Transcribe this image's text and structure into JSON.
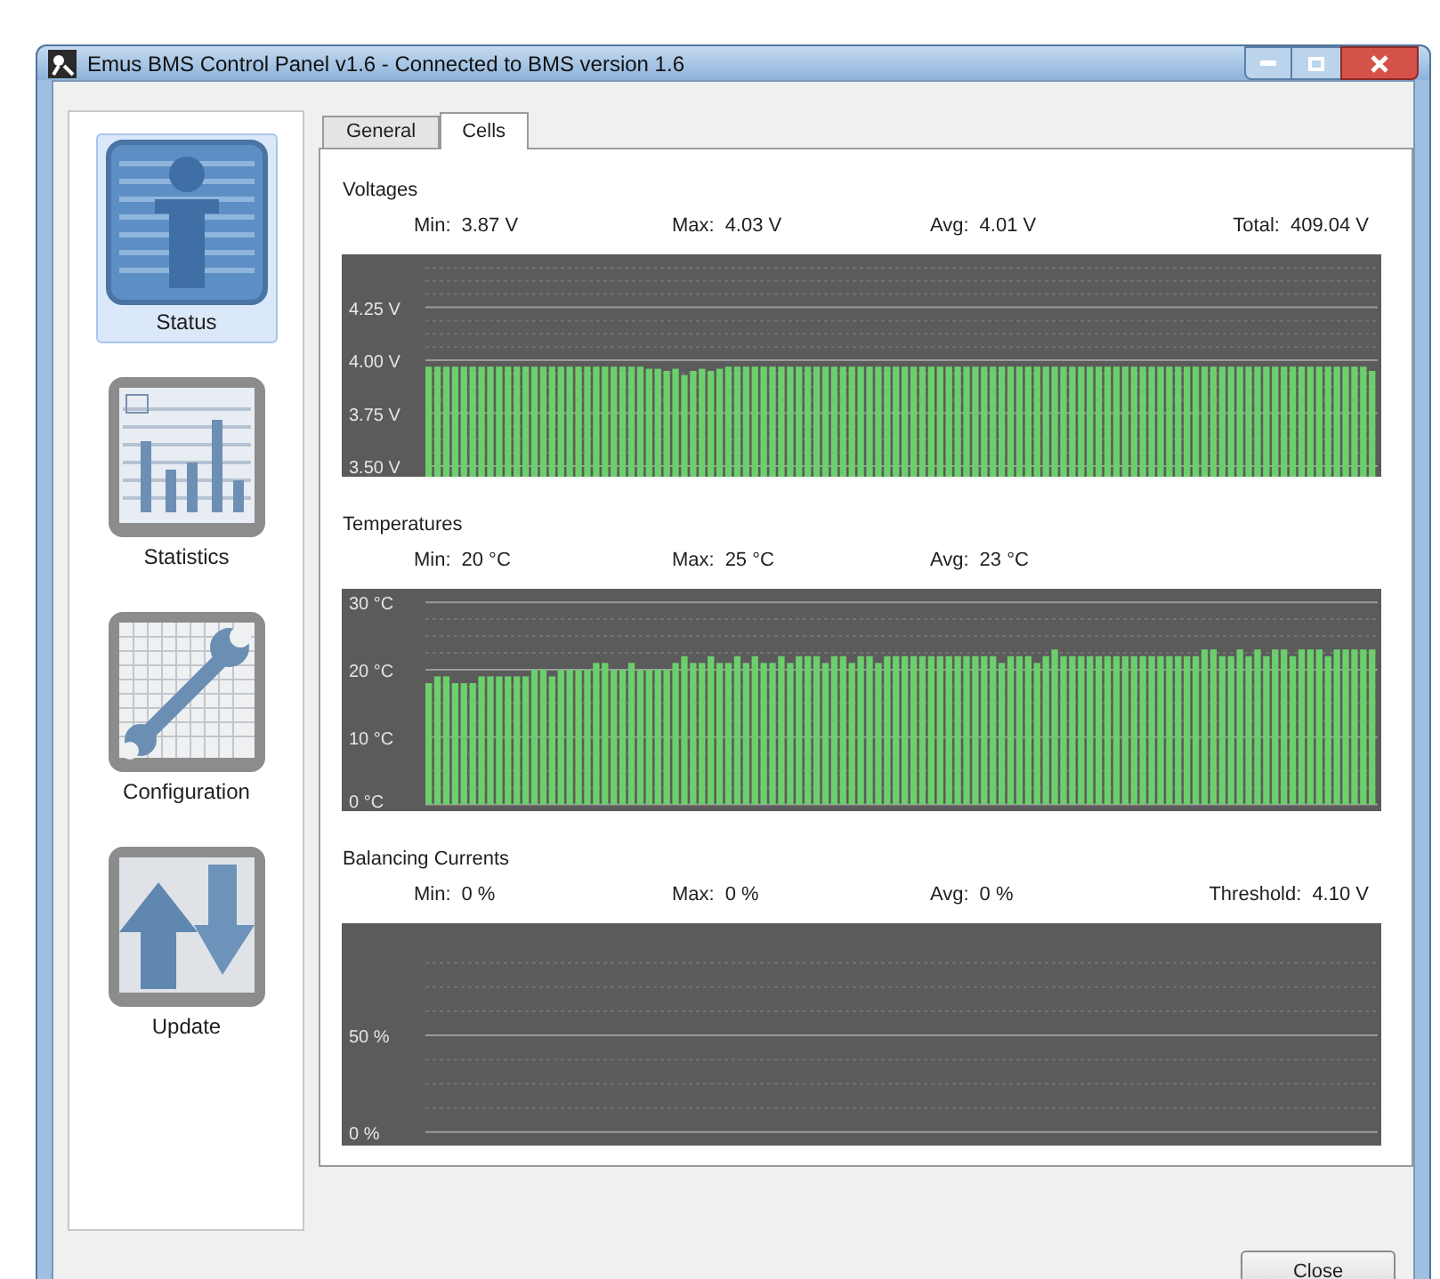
{
  "window": {
    "title": "Emus BMS Control Panel v1.6 - Connected to BMS version 1.6"
  },
  "sidebar": {
    "items": [
      {
        "label": "Status",
        "kind": "status",
        "selected": true
      },
      {
        "label": "Statistics",
        "kind": "statistics",
        "selected": false
      },
      {
        "label": "Configuration",
        "kind": "configuration",
        "selected": false
      },
      {
        "label": "Update",
        "kind": "update",
        "selected": false
      }
    ]
  },
  "tabs": [
    {
      "label": "General",
      "selected": false
    },
    {
      "label": "Cells",
      "selected": true
    }
  ],
  "sections": [
    {
      "title": "Voltages",
      "stats": [
        {
          "label": "Min:",
          "value": "3.87 V"
        },
        {
          "label": "Max:",
          "value": "4.03 V"
        },
        {
          "label": "Avg:",
          "value": "4.01 V"
        },
        {
          "label": "Total:",
          "value": "409.04 V"
        }
      ],
      "chart_data": {
        "type": "bar",
        "ylim": [
          3.45,
          4.5
        ],
        "yticks": [
          {
            "value": 3.5,
            "label": "3.50 V"
          },
          {
            "value": 3.75,
            "label": "3.75 V"
          },
          {
            "value": 4.0,
            "label": "4.00 V"
          },
          {
            "value": 4.25,
            "label": "4.25 V"
          }
        ],
        "grid": true,
        "color": "#6ccf6c",
        "values": [
          3.97,
          3.97,
          3.97,
          3.97,
          3.97,
          3.97,
          3.97,
          3.97,
          3.97,
          3.97,
          3.97,
          3.97,
          3.97,
          3.97,
          3.97,
          3.97,
          3.97,
          3.97,
          3.97,
          3.97,
          3.97,
          3.97,
          3.97,
          3.97,
          3.97,
          3.96,
          3.96,
          3.95,
          3.96,
          3.93,
          3.95,
          3.96,
          3.95,
          3.96,
          3.97,
          3.97,
          3.97,
          3.97,
          3.97,
          3.97,
          3.97,
          3.97,
          3.97,
          3.97,
          3.97,
          3.97,
          3.97,
          3.97,
          3.97,
          3.97,
          3.97,
          3.97,
          3.97,
          3.97,
          3.97,
          3.97,
          3.97,
          3.97,
          3.97,
          3.97,
          3.97,
          3.97,
          3.97,
          3.97,
          3.97,
          3.97,
          3.97,
          3.97,
          3.97,
          3.97,
          3.97,
          3.97,
          3.97,
          3.97,
          3.97,
          3.97,
          3.97,
          3.97,
          3.97,
          3.97,
          3.97,
          3.97,
          3.97,
          3.97,
          3.97,
          3.97,
          3.97,
          3.97,
          3.97,
          3.97,
          3.97,
          3.97,
          3.97,
          3.97,
          3.97,
          3.97,
          3.97,
          3.97,
          3.97,
          3.97,
          3.97,
          3.97,
          3.97,
          3.97,
          3.97,
          3.97,
          3.97,
          3.95
        ]
      }
    },
    {
      "title": "Temperatures",
      "stats": [
        {
          "label": "Min:",
          "value": "20 °C"
        },
        {
          "label": "Max:",
          "value": "25 °C"
        },
        {
          "label": "Avg:",
          "value": "23 °C"
        }
      ],
      "chart_data": {
        "type": "bar",
        "ylim": [
          -1,
          32
        ],
        "yticks": [
          {
            "value": 0,
            "label": "0 °C"
          },
          {
            "value": 10,
            "label": "10 °C"
          },
          {
            "value": 20,
            "label": "20 °C"
          },
          {
            "value": 30,
            "label": "30 °C"
          }
        ],
        "grid": true,
        "color": "#6ccf6c",
        "values": [
          18,
          19,
          19,
          18,
          18,
          18,
          19,
          19,
          19,
          19,
          19,
          19,
          20,
          20,
          19,
          20,
          20,
          20,
          20,
          21,
          21,
          20,
          20,
          21,
          20,
          20,
          20,
          20,
          21,
          22,
          21,
          21,
          22,
          21,
          21,
          22,
          21,
          22,
          21,
          21,
          22,
          21,
          22,
          22,
          22,
          21,
          22,
          22,
          21,
          22,
          22,
          21,
          22,
          22,
          22,
          22,
          22,
          22,
          22,
          22,
          22,
          22,
          22,
          22,
          22,
          21,
          22,
          22,
          22,
          21,
          22,
          23,
          22,
          22,
          22,
          22,
          22,
          22,
          22,
          22,
          22,
          22,
          22,
          22,
          22,
          22,
          22,
          22,
          23,
          23,
          22,
          22,
          23,
          22,
          23,
          22,
          23,
          23,
          22,
          23,
          23,
          23,
          22,
          23,
          23,
          23,
          23,
          23
        ]
      }
    },
    {
      "title": "Balancing Currents",
      "stats": [
        {
          "label": "Min:",
          "value": "0 %"
        },
        {
          "label": "Max:",
          "value": "0 %"
        },
        {
          "label": "Avg:",
          "value": "0 %"
        },
        {
          "label": "Threshold:",
          "value": "4.10 V"
        }
      ],
      "chart_data": {
        "type": "bar",
        "ylim": [
          -7,
          108
        ],
        "yticks": [
          {
            "value": 0,
            "label": "0 %"
          },
          {
            "value": 50,
            "label": "50 %"
          }
        ],
        "grid": true,
        "color": "#6ccf6c",
        "values": [
          0,
          0,
          0,
          0,
          0,
          0,
          0,
          0,
          0,
          0,
          0,
          0,
          0,
          0,
          0,
          0,
          0,
          0,
          0,
          0,
          0,
          0,
          0,
          0,
          0,
          0,
          0,
          0,
          0,
          0,
          0,
          0,
          0,
          0,
          0,
          0,
          0,
          0,
          0,
          0,
          0,
          0,
          0,
          0,
          0,
          0,
          0,
          0,
          0,
          0,
          0,
          0,
          0,
          0,
          0,
          0,
          0,
          0,
          0,
          0,
          0,
          0,
          0,
          0,
          0,
          0,
          0,
          0,
          0,
          0,
          0,
          0,
          0,
          0,
          0,
          0,
          0,
          0,
          0,
          0,
          0,
          0,
          0,
          0,
          0,
          0,
          0,
          0,
          0,
          0,
          0,
          0,
          0,
          0,
          0,
          0,
          0,
          0,
          0,
          0,
          0,
          0,
          0,
          0,
          0,
          0,
          0,
          0
        ]
      }
    }
  ],
  "buttons": [
    {
      "label": "Close"
    }
  ]
}
